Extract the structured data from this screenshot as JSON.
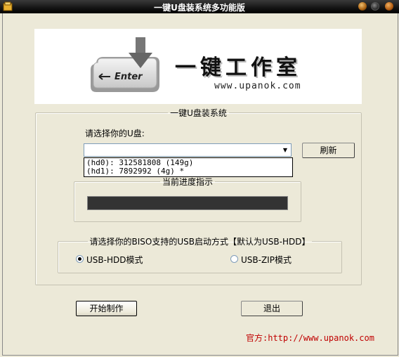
{
  "window": {
    "title": "一键U盘装系统多功能版"
  },
  "banner": {
    "title": "一键工作室",
    "url": "www.upanok.com",
    "key_label": "Enter"
  },
  "system_group": {
    "legend": "一键U盘装系统"
  },
  "select_usb": {
    "label": "请选择你的U盘:",
    "value": ""
  },
  "dropdown": {
    "options": [
      "(hd0): 312581808 (149g)",
      "(hd1): 7892992 (4g) *"
    ]
  },
  "refresh_button": {
    "label": "刷新"
  },
  "progress": {
    "legend": "当前进度指示",
    "value": 0
  },
  "boot_mode": {
    "legend": "请选择你的BISO支持的USB启动方式【默认为USB-HDD】",
    "options": [
      {
        "label": "USB-HDD模式",
        "selected": true
      },
      {
        "label": "USB-ZIP模式",
        "selected": false
      }
    ]
  },
  "actions": {
    "start": "开始制作",
    "exit": "退出"
  },
  "footer": {
    "official": "官方:http://www.upanok.com"
  },
  "colors": {
    "link_red": "#c00000",
    "titlebar": "#1a1a1a"
  }
}
